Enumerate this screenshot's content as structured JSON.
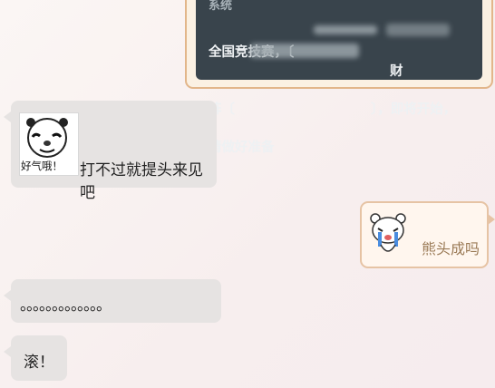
{
  "system_card": {
    "sender": "系统",
    "text": "全国竞技赛，〔\n阵〔\n请做好准备",
    "text_part_mid_1": "财",
    "text_part_mid_2": "〕，即将开始，"
  },
  "messages": [
    {
      "side": "left",
      "sticker_caption": "好气哦！",
      "text": "打不过就提头来见吧"
    },
    {
      "side": "right",
      "text": "熊头成吗"
    },
    {
      "side": "left",
      "text": "。。。。。。。。。。。。。"
    },
    {
      "side": "left",
      "text": "滚！"
    }
  ],
  "colors": {
    "left_bubble": "#e6e3e2",
    "right_bubble_border": "#e6c3a4",
    "right_bubble_text": "#9b7b57",
    "system_bg": "#39444c"
  },
  "icons": [
    "panda-meme-sticker",
    "crying-bear-sticker"
  ]
}
